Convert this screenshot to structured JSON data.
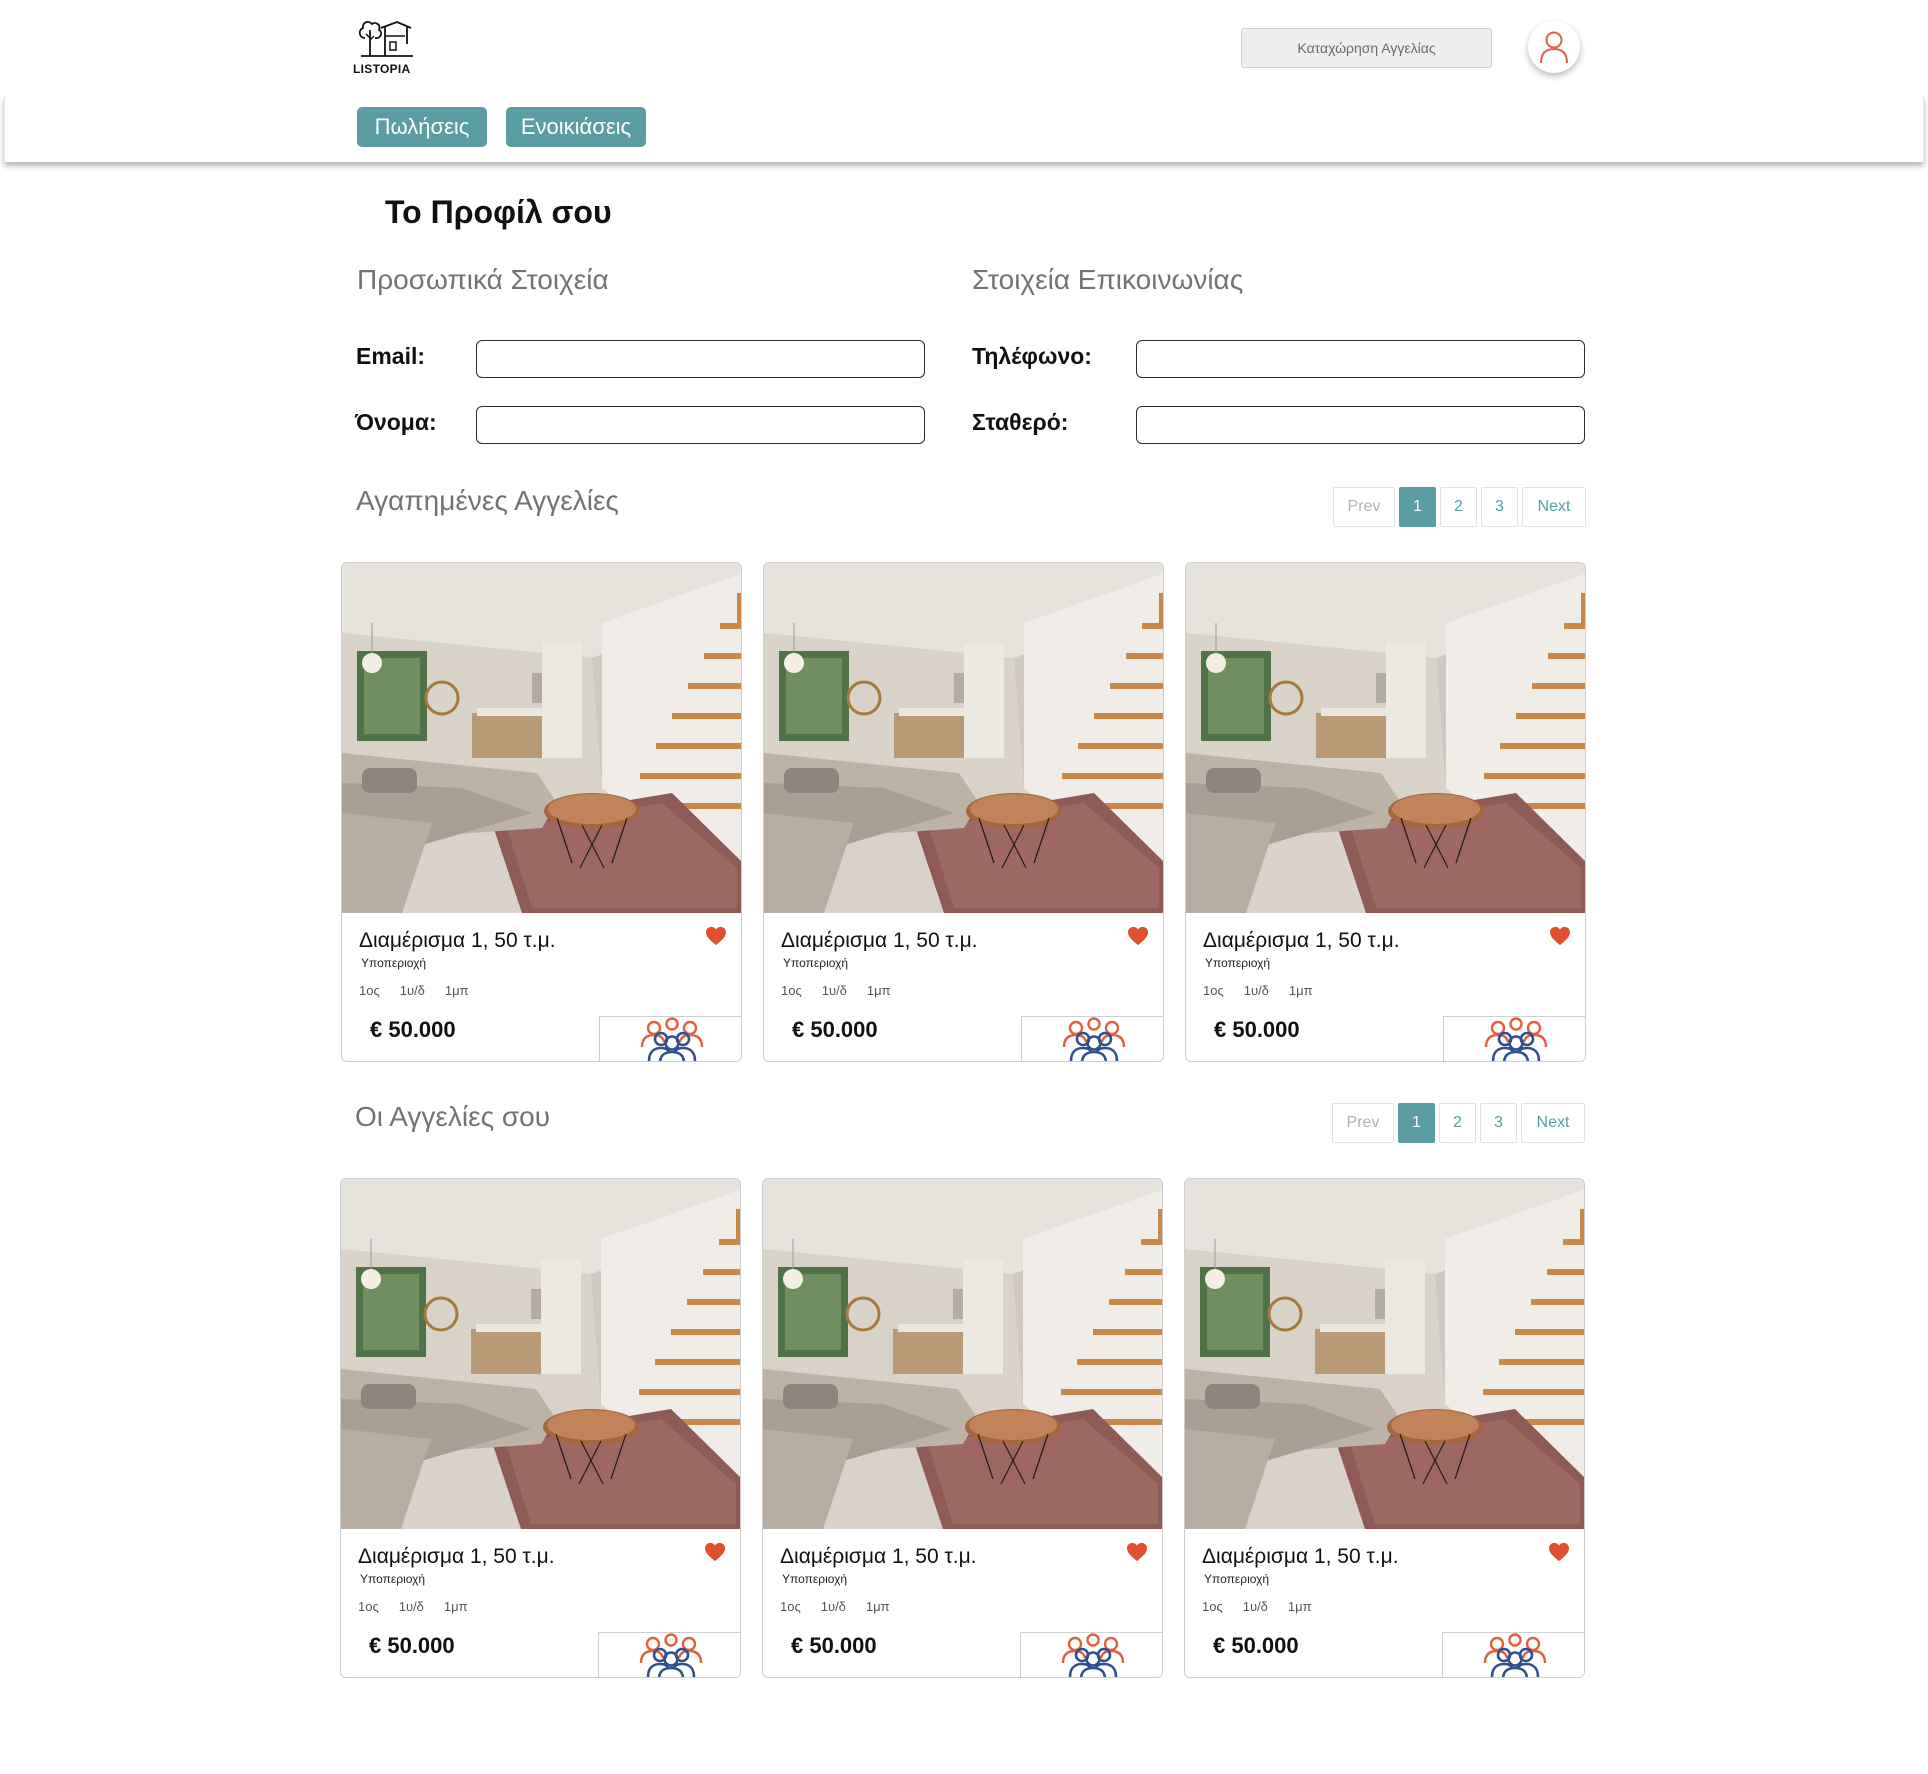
{
  "header": {
    "logo_text": "LISTOPIA",
    "post_ad_label": "Καταχώρηση Αγγελίας"
  },
  "nav": {
    "tabs": [
      "Πωλήσεις",
      "Ενοικιάσεις"
    ]
  },
  "profile": {
    "title": "Το Προφίλ σου",
    "personal": {
      "heading": "Προσωπικά Στοιχεία",
      "email_label": "Email:",
      "email_value": "",
      "name_label": "Όνομα:",
      "name_value": ""
    },
    "contact": {
      "heading": "Στοιχεία Επικοινωνίας",
      "phone_label": "Τηλέφωνο:",
      "phone_value": "",
      "landline_label": "Σταθερό:",
      "landline_value": ""
    }
  },
  "favorites": {
    "heading": "Αγαπημένες Αγγελίες",
    "pagination": {
      "prev": "Prev",
      "pages": [
        "1",
        "2",
        "3"
      ],
      "active": "1",
      "next": "Next"
    },
    "cards": [
      {
        "title": "Διαμέρισμα 1, 50 τ.μ.",
        "subarea": "Υποπεριοχή",
        "floor": "1ος",
        "bath": "1υ/δ",
        "rooms": "1μπ",
        "price": "€ 50.000"
      },
      {
        "title": "Διαμέρισμα 1, 50 τ.μ.",
        "subarea": "Υποπεριοχή",
        "floor": "1ος",
        "bath": "1υ/δ",
        "rooms": "1μπ",
        "price": "€ 50.000"
      },
      {
        "title": "Διαμέρισμα 1, 50 τ.μ.",
        "subarea": "Υποπεριοχή",
        "floor": "1ος",
        "bath": "1υ/δ",
        "rooms": "1μπ",
        "price": "€ 50.000"
      }
    ]
  },
  "my_listings": {
    "heading": "Οι Αγγελίες σου",
    "pagination": {
      "prev": "Prev",
      "pages": [
        "1",
        "2",
        "3"
      ],
      "active": "1",
      "next": "Next"
    },
    "cards": [
      {
        "title": "Διαμέρισμα 1, 50 τ.μ.",
        "subarea": "Υποπεριοχή",
        "floor": "1ος",
        "bath": "1υ/δ",
        "rooms": "1μπ",
        "price": "€ 50.000"
      },
      {
        "title": "Διαμέρισμα 1, 50 τ.μ.",
        "subarea": "Υποπεριοχή",
        "floor": "1ος",
        "bath": "1υ/δ",
        "rooms": "1μπ",
        "price": "€ 50.000"
      },
      {
        "title": "Διαμέρισμα 1, 50 τ.μ.",
        "subarea": "Υποπεριοχή",
        "floor": "1ος",
        "bath": "1υ/δ",
        "rooms": "1μπ",
        "price": "€ 50.000"
      }
    ]
  },
  "icons": {
    "favorite": "heart-icon",
    "agent": "people-group-icon",
    "user": "user-icon"
  },
  "colors": {
    "accent": "#5a9ea4",
    "heart": "#e0502e",
    "agent_orange": "#e0613e",
    "agent_blue": "#2f4f8f"
  }
}
